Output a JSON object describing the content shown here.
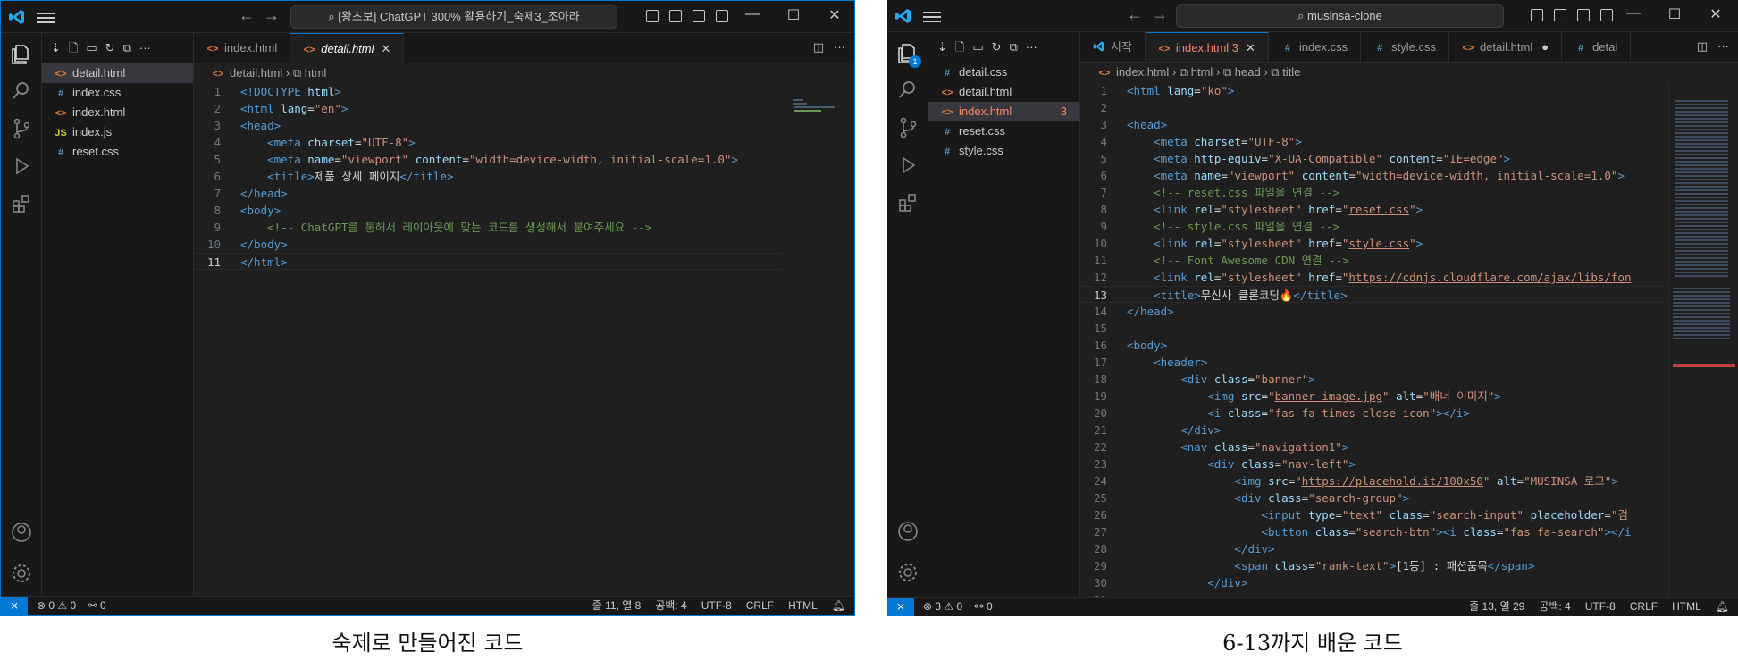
{
  "left": {
    "title": "[왕초보] ChatGPT 300% 활용하기_숙제3_조아라",
    "files": [
      {
        "name": "detail.html",
        "icon": "html",
        "selected": true
      },
      {
        "name": "index.css",
        "icon": "css"
      },
      {
        "name": "index.html",
        "icon": "html"
      },
      {
        "name": "index.js",
        "icon": "js"
      },
      {
        "name": "reset.css",
        "icon": "css"
      }
    ],
    "tabs": [
      {
        "label": "index.html",
        "icon": "html",
        "active": false
      },
      {
        "label": "detail.html",
        "icon": "html",
        "active": true
      }
    ],
    "breadcrumb": [
      "detail.html",
      "html"
    ],
    "status": {
      "problems": "0 ⚠ 0",
      "ports": "0",
      "position": "줄 11, 열 8",
      "spaces": "공백: 4",
      "encoding": "UTF-8",
      "eol": "CRLF",
      "language": "HTML"
    },
    "caption": "숙제로 만들어진 코드"
  },
  "right": {
    "title": "musinsa-clone",
    "files": [
      {
        "name": "detail.css",
        "icon": "css"
      },
      {
        "name": "detail.html",
        "icon": "html"
      },
      {
        "name": "index.html",
        "icon": "html",
        "selected": true,
        "badge": "3"
      },
      {
        "name": "reset.css",
        "icon": "css"
      },
      {
        "name": "style.css",
        "icon": "css"
      }
    ],
    "tabs": [
      {
        "label": "시작",
        "icon": "vs"
      },
      {
        "label": "index.html 3",
        "icon": "html",
        "active": true
      },
      {
        "label": "index.css",
        "icon": "css"
      },
      {
        "label": "style.css",
        "icon": "css"
      },
      {
        "label": "detail.html",
        "icon": "html",
        "dirty": true
      },
      {
        "label": "detai",
        "icon": "css"
      }
    ],
    "breadcrumb": [
      "index.html",
      "html",
      "head",
      "title"
    ],
    "explorer_badge": "1",
    "status": {
      "problems": "3 ⚠ 0",
      "ports": "0",
      "position": "줄 13, 열 29",
      "spaces": "공백: 4",
      "encoding": "UTF-8",
      "eol": "CRLF",
      "language": "HTML"
    },
    "caption": "6-13까지 배운 코드"
  }
}
